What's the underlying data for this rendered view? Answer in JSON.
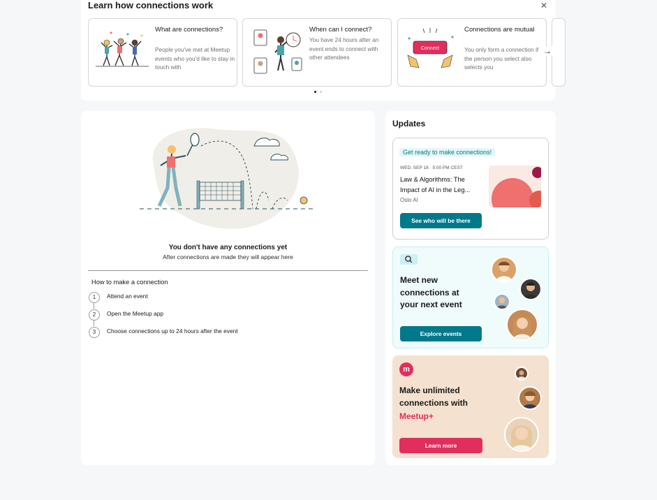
{
  "learn": {
    "title": "Learn how connections work",
    "close_icon": "close-icon",
    "cards": [
      {
        "title": "What are connections?",
        "body": "People you've met at Meetup events who you'd like to stay in touch with",
        "icon": "people-celebrating-illustration"
      },
      {
        "title": "When can I connect?",
        "body": "You have 24 hours after an event ends to connect with other attendees",
        "icon": "clock-illustration"
      },
      {
        "title": "Connections are mutual",
        "body": "You only form a connection if the person you select also selects you",
        "icon": "connect-button-illustration"
      }
    ],
    "next_icon": "arrow-right-icon",
    "carousel": {
      "page_count": 2,
      "active_index": 0
    }
  },
  "main": {
    "empty_title": "You don't have any connections yet",
    "empty_subtitle": "After connections are made they will appear here",
    "how_title": "How to make a connection",
    "steps": [
      {
        "num": "1",
        "text": "Attend an event"
      },
      {
        "num": "2",
        "text": "Open the Meetup app"
      },
      {
        "num": "3",
        "text": "Choose connections up to 24 hours after the event"
      }
    ]
  },
  "updates": {
    "title": "Updates",
    "event_card": {
      "badge": "Get ready to make connections!",
      "date": "WED, SEP 18 · 5:00 PM CEST",
      "name": "Law & Algorithms: The Impact of AI in the Leg...",
      "group": "Oslo AI",
      "button": "See who will be there"
    },
    "meet_card": {
      "search_icon": "search-icon",
      "title": "Meet new connections at your next event",
      "button": "Explore events"
    },
    "plus_card": {
      "logo": "m",
      "title": "Make unlimited connections with",
      "brand": "Meetup+",
      "button": "Learn more"
    }
  },
  "colors": {
    "teal": "#00798a",
    "pink": "#e22e5c",
    "badge_bg": "#e4f6f7",
    "meet_bg": "#f0fbfc",
    "plus_bg": "#f4e1cf",
    "page_bg": "#f6f7f8"
  }
}
